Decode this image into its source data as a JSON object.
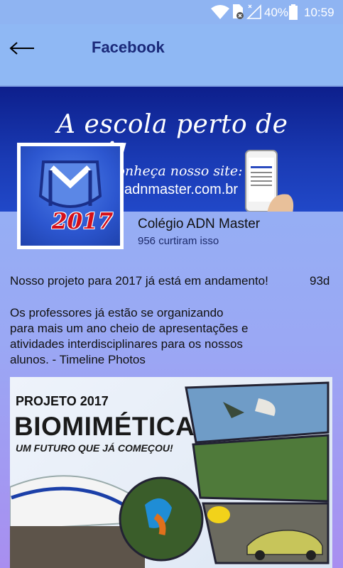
{
  "status_bar": {
    "battery_percent": "40%",
    "time": "10:59"
  },
  "app_bar": {
    "title": "Facebook"
  },
  "cover": {
    "slogan": "A escola perto de você!",
    "site_label": "Conheça nosso site:",
    "site_url": "adnmaster.com.br"
  },
  "profile": {
    "year_badge": "2017",
    "name": "Colégio ADN Master",
    "likes": "956 curtiram isso"
  },
  "post": {
    "headline": "Nosso projeto para 2017 já está em andamento!",
    "age": "93d",
    "body": "Os professores já estão se organizando\npara mais um ano cheio de apresentações e\natividades interdisciplinares para os nossos\nalunos. - Timeline Photos",
    "image": {
      "line1": "PROJETO 2017",
      "line2": "BIOMIMÉTICA",
      "line3": "UM FUTURO QUE JÁ COMEÇOU!"
    }
  },
  "colors": {
    "app_bar": "#8fb8f4",
    "title": "#1b2a7a",
    "banner": "#1a3bb5",
    "accent_red": "#d4101a"
  }
}
